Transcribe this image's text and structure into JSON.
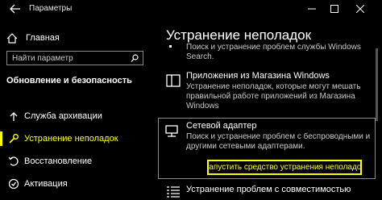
{
  "window": {
    "title": "Параметры"
  },
  "sidebar": {
    "home_label": "Главная",
    "search_placeholder": "Найти параметр",
    "section_title": "Обновление и безопасность",
    "items": [
      {
        "label": "Служба архивации",
        "icon": "backup-icon"
      },
      {
        "label": "Устранение неполадок",
        "icon": "wrench-icon",
        "active": true
      },
      {
        "label": "Восстановление",
        "icon": "recovery-icon"
      },
      {
        "label": "Активация",
        "icon": "activation-icon"
      }
    ]
  },
  "main": {
    "title": "Устранение неполадок",
    "fragment_line1": "Поиск и устранение проблем службы Windows",
    "fragment_line2": "Search.",
    "store_apps": {
      "title": "Приложения из Магазина Windows",
      "desc": "Устранение неполадок, которые могут мешать правильной работе приложений из Магазина Windows"
    },
    "network_adapter": {
      "title": "Сетевой адаптер",
      "desc": "Поиск и устранение проблем с беспроводными и другими сетевыми адаптерами.",
      "run_button": "Запустить средство устранения неполадок"
    },
    "compatibility": {
      "title": "Устранение проблем с совместимостью"
    }
  },
  "colors": {
    "accent": "#ffff00",
    "background": "#000000",
    "text": "#ffffff",
    "border": "#8a8a8a"
  }
}
